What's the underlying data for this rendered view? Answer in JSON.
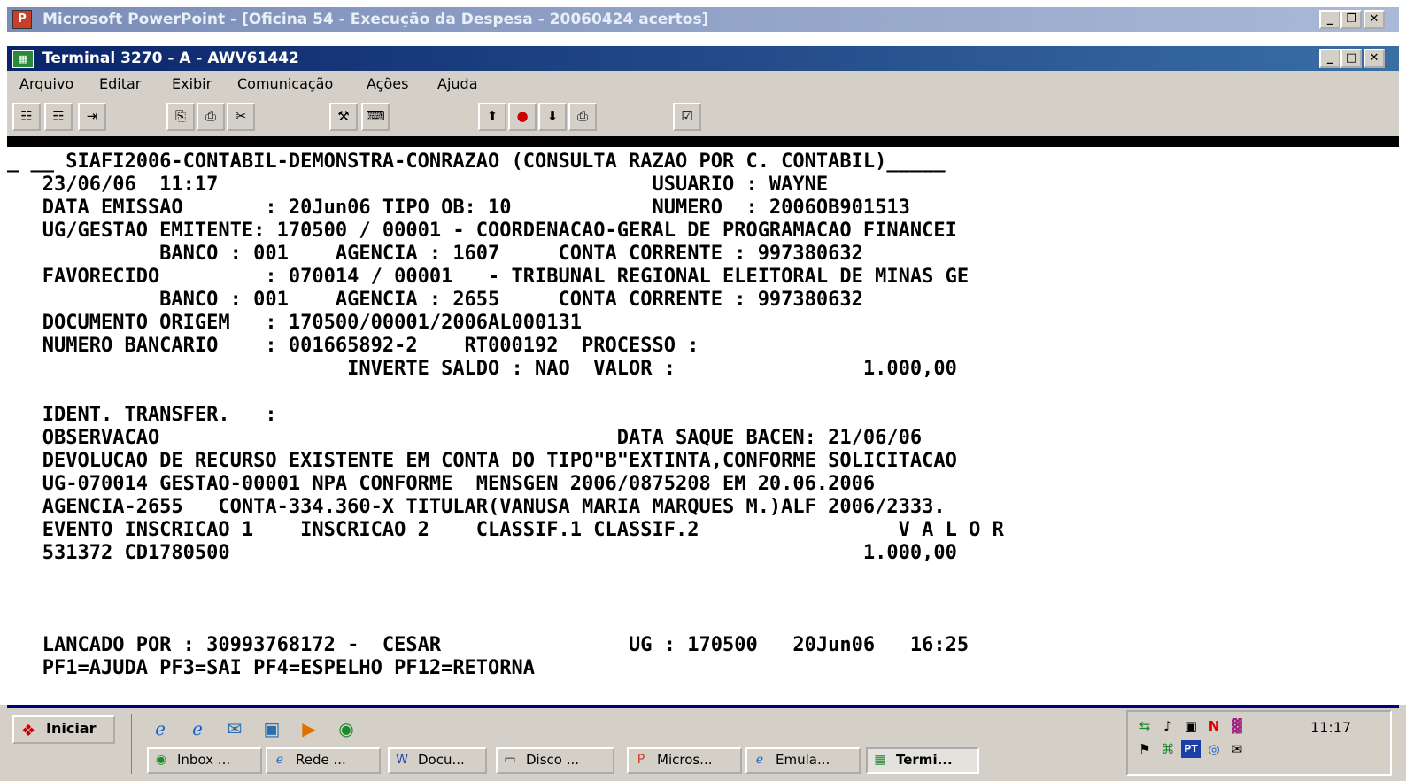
{
  "ppt_window": {
    "title": "Microsoft PowerPoint - [Oficina 54 - Execução da Despesa - 20060424 acertos]",
    "icon": "powerpoint-icon"
  },
  "terminal_window": {
    "title": "Terminal 3270 - A - AWV61442",
    "icon": "terminal-icon"
  },
  "menu": [
    "Arquivo",
    "Editar",
    "Exibir",
    "Comunicação",
    "Ações",
    "Ajuda"
  ],
  "toolbar_icons": [
    "connect-icon",
    "disconnect-icon",
    "send-file-icon",
    "copy-icon",
    "paste-icon",
    "cut-icon",
    "settings-icon",
    "keyboard-icon",
    "transfer-up-icon",
    "record-icon",
    "transfer-down-icon",
    "print-icon",
    "screen-icon"
  ],
  "terminal_lines": [
    "_ __ SIAFI2006-CONTABIL-DEMONSTRA-CONRAZAO (CONSULTA RAZAO POR C. CONTABIL)_____",
    "   23/06/06  11:17                                     USUARIO : WAYNE",
    "   DATA EMISSAO       : 20Jun06 TIPO OB: 10            NUMERO  : 2006OB901513",
    "   UG/GESTAO EMITENTE: 170500 / 00001 - COORDENACAO-GERAL DE PROGRAMACAO FINANCEI",
    "             BANCO : 001    AGENCIA : 1607     CONTA CORRENTE : 997380632",
    "   FAVORECIDO         : 070014 / 00001   - TRIBUNAL REGIONAL ELEITORAL DE MINAS GE",
    "             BANCO : 001    AGENCIA : 2655     CONTA CORRENTE : 997380632",
    "   DOCUMENTO ORIGEM   : 170500/00001/2006AL000131",
    "   NUMERO BANCARIO    : 001665892-2    RT000192  PROCESSO :",
    "                             INVERTE SALDO : NAO  VALOR :                1.000,00",
    "",
    "   IDENT. TRANSFER.   :",
    "   OBSERVACAO                                       DATA SAQUE BACEN: 21/06/06",
    "   DEVOLUCAO DE RECURSO EXISTENTE EM CONTA DO TIPO\"B\"EXTINTA,CONFORME SOLICITACAO",
    "   UG-070014 GESTAO-00001 NPA CONFORME  MENSGEN 2006/0875208 EM 20.06.2006",
    "   AGENCIA-2655   CONTA-334.360-X TITULAR(VANUSA MARIA MARQUES M.)ALF 2006/2333.",
    "   EVENTO INSCRICAO 1    INSCRICAO 2    CLASSIF.1 CLASSIF.2                 V A L O R",
    "   531372 CD1780500                                                      1.000,00",
    "",
    "",
    "",
    "   LANCADO POR : 30993768172 -  CESAR                UG : 170500   20Jun06   16:25",
    "   PF1=AJUDA PF3=SAI PF4=ESPELHO PF12=RETORNA"
  ],
  "taskbar": {
    "start_label": "Iniciar",
    "quick_launch": [
      "ie-icon",
      "ie-icon",
      "outlook-icon",
      "desktop-icon",
      "media-icon",
      "app-icon"
    ],
    "tasks": [
      {
        "label": "Inbox ...",
        "icon": "mail-icon"
      },
      {
        "label": "Rede ...",
        "icon": "ie-icon"
      },
      {
        "label": "Docu...",
        "icon": "word-icon"
      },
      {
        "label": "Disco ...",
        "icon": "disk-icon"
      },
      {
        "label": "Micros...",
        "icon": "powerpoint-icon"
      },
      {
        "label": "Emula...",
        "icon": "ie-icon"
      },
      {
        "label": "Termi...",
        "icon": "terminal-icon",
        "active": true
      }
    ],
    "clock": "11:17"
  }
}
